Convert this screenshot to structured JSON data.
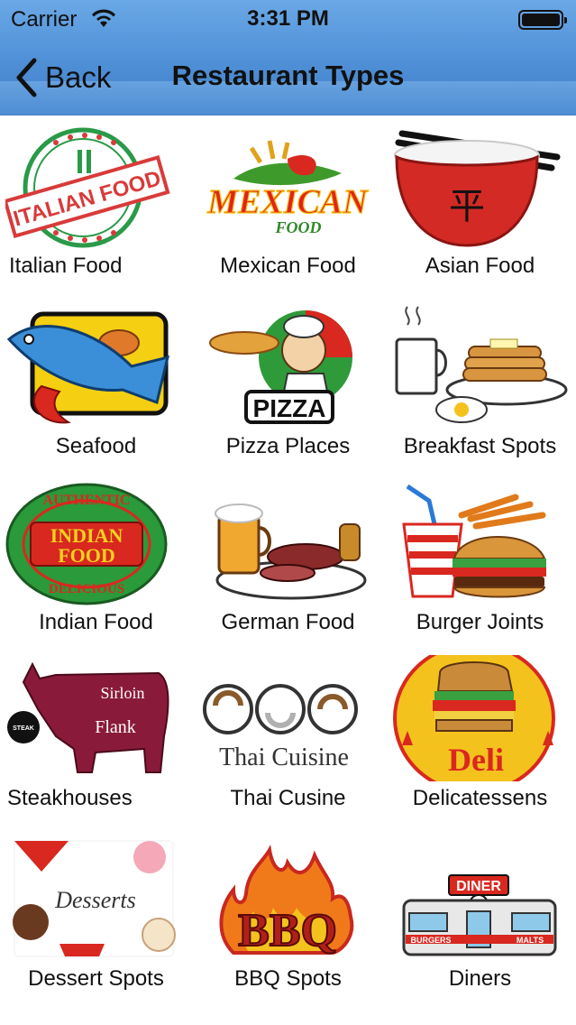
{
  "status_bar": {
    "carrier": "Carrier",
    "time": "3:31 PM"
  },
  "nav": {
    "back_label": "Back",
    "title": "Restaurant Types"
  },
  "categories": [
    {
      "label": "Italian Food",
      "logo_text": "ITALIAN FOOD"
    },
    {
      "label": "Mexican Food",
      "logo_text": "MEXICAN",
      "logo_sub": "FOOD"
    },
    {
      "label": "Asian Food",
      "logo_text": "平"
    },
    {
      "label": "Seafood"
    },
    {
      "label": "Pizza Places",
      "logo_text": "PIZZA"
    },
    {
      "label": "Breakfast Spots"
    },
    {
      "label": "Indian Food",
      "logo_text": "INDIAN",
      "logo_sub": "FOOD",
      "logo_top": "AUTHENTIC",
      "logo_bottom": "DELICIOUS"
    },
    {
      "label": "German Food"
    },
    {
      "label": "Burger Joints"
    },
    {
      "label": "Steakhouses",
      "logo_text": "Sirloin",
      "logo_sub": "Flank",
      "logo_badge": "STEAK"
    },
    {
      "label": "Thai Cusine",
      "logo_text": "Thai Cuisine"
    },
    {
      "label": "Delicatessens",
      "logo_text": "Deli"
    },
    {
      "label": "Dessert Spots",
      "logo_text": "Desserts"
    },
    {
      "label": "BBQ Spots",
      "logo_text": "BBQ"
    },
    {
      "label": "Diners",
      "logo_text": "DINER",
      "logo_sub": "BURGERS",
      "logo_extra": "MALTS"
    }
  ]
}
